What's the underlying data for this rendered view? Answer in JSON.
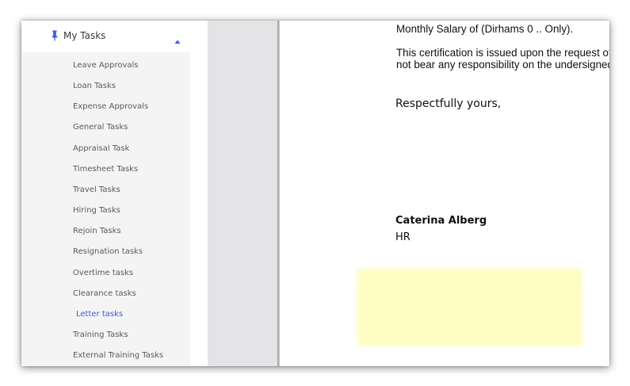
{
  "sidebar": {
    "section_title": "My Tasks",
    "icons": {
      "pin": "pin-icon",
      "collapse": "caret-up-icon"
    },
    "items": [
      {
        "label": "Leave Approvals"
      },
      {
        "label": "Loan Tasks"
      },
      {
        "label": "Expense Approvals"
      },
      {
        "label": "General Tasks"
      },
      {
        "label": "Appraisal Task"
      },
      {
        "label": "Timesheet Tasks"
      },
      {
        "label": "Travel Tasks"
      },
      {
        "label": "Hiring Tasks"
      },
      {
        "label": "Rejoin Tasks"
      },
      {
        "label": "Resignation tasks"
      },
      {
        "label": "Overtime tasks"
      },
      {
        "label": "Clearance tasks"
      },
      {
        "label": "Letter tasks",
        "active": true
      },
      {
        "label": "Training Tasks"
      },
      {
        "label": "External Training Tasks"
      }
    ]
  },
  "document": {
    "line1": "Monthly Salary of (Dirhams 0 .. Only).",
    "line2": "This certification is issued upon the request of",
    "line3": "not bear any responsibility on the undersigned",
    "closing": "Respectfully yours,",
    "signer_name": "Caterina Alberg",
    "signer_role": "HR"
  },
  "colors": {
    "accent": "#3b5bd6",
    "sidebar_bg": "#f4f4f5",
    "highlight": "#fffdc4"
  }
}
